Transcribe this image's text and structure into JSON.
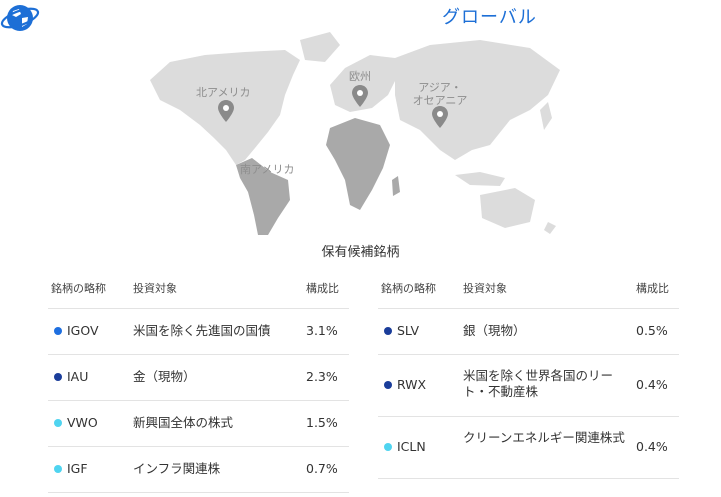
{
  "map": {
    "global_label": "グローバル",
    "regions": [
      {
        "name": "北アメリカ"
      },
      {
        "name": "欧州"
      },
      {
        "name": "アジア・\nオセアニア"
      },
      {
        "name": "南アメリカ"
      }
    ]
  },
  "section_title": "保有候補銘柄",
  "tables": [
    {
      "headers": {
        "ticker": "銘柄の略称",
        "target": "投資対象",
        "ratio": "構成比"
      },
      "rows": [
        {
          "ticker": "IGOV",
          "target": "米国を除く先進国の国債",
          "ratio": "3.1%",
          "color": "#1e6fe0"
        },
        {
          "ticker": "IAU",
          "target": "金（現物）",
          "ratio": "2.3%",
          "color": "#1a3d9a"
        },
        {
          "ticker": "VWO",
          "target": "新興国全体の株式",
          "ratio": "1.5%",
          "color": "#4fd4f0"
        },
        {
          "ticker": "IGF",
          "target": "インフラ関連株",
          "ratio": "0.7%",
          "color": "#4fd4f0"
        }
      ]
    },
    {
      "headers": {
        "ticker": "銘柄の略称",
        "target": "投資対象",
        "ratio": "構成比"
      },
      "rows": [
        {
          "ticker": "SLV",
          "target": "銀（現物）",
          "ratio": "0.5%",
          "color": "#1a3d9a"
        },
        {
          "ticker": "RWX",
          "target": "米国を除く世界各国のリート・不動産株",
          "ratio": "0.4%",
          "color": "#1a3d9a"
        },
        {
          "ticker": "ICLN",
          "target": "クリーンエネルギー関連株式",
          "ratio": "0.4%",
          "color": "#4fd4f0"
        }
      ]
    }
  ]
}
